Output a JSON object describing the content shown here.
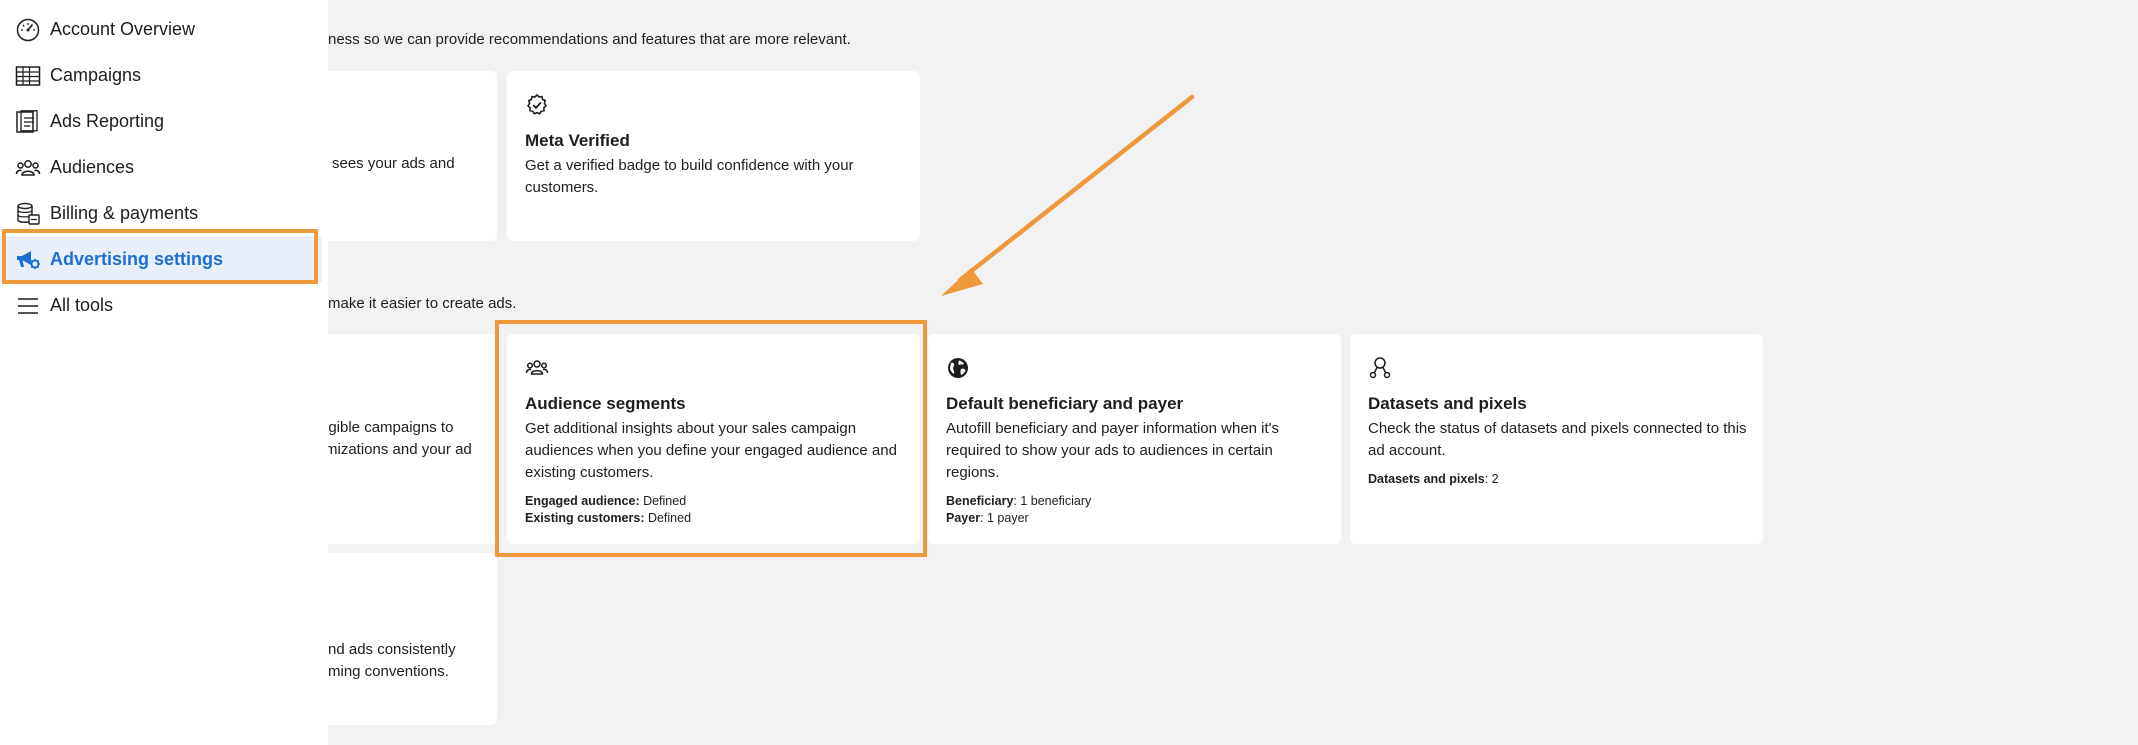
{
  "sidebar": {
    "items": [
      {
        "label": "Account Overview",
        "icon": "speedometer-icon"
      },
      {
        "label": "Campaigns",
        "icon": "table-icon"
      },
      {
        "label": "Ads Reporting",
        "icon": "report-icon"
      },
      {
        "label": "Audiences",
        "icon": "people-icon"
      },
      {
        "label": "Billing & payments",
        "icon": "coins-icon"
      },
      {
        "label": "Advertising settings",
        "icon": "megaphone-gear-icon",
        "active": true
      },
      {
        "label": "All tools",
        "icon": "menu-icon"
      }
    ]
  },
  "main": {
    "section1_desc": "ness so we can provide recommendations and features that are more relevant.",
    "section2_desc": "make it easier to create ads.",
    "partial_card_1": {
      "line1": "sees your ads and"
    },
    "partial_card_2": {
      "line1": "igible campaigns to",
      "line2": "mizations and your ad"
    },
    "partial_card_3": {
      "line1": "nd ads consistently",
      "line2": "ming conventions."
    },
    "meta_verified": {
      "title": "Meta Verified",
      "desc": "Get a verified badge to build confidence with your customers.",
      "icon": "verified-badge-icon"
    },
    "audience_segments": {
      "title": "Audience segments",
      "desc": "Get additional insights about your sales campaign audiences when you define your engaged audience and existing customers.",
      "icon": "people-icon",
      "meta1_label": "Engaged audience:",
      "meta1_value": " Defined",
      "meta2_label": "Existing customers:",
      "meta2_value": " Defined"
    },
    "beneficiary": {
      "title": "Default beneficiary and payer",
      "desc": "Autofill beneficiary and payer information when it's required to show your ads to audiences in certain regions.",
      "icon": "globe-icon",
      "meta1_label": "Beneficiary",
      "meta1_value": ": 1 beneficiary",
      "meta2_label": "Payer",
      "meta2_value": ": 1 payer"
    },
    "datasets": {
      "title": "Datasets and pixels",
      "desc": "Check the status of datasets and pixels connected to this ad account.",
      "icon": "dataset-nodes-icon",
      "meta1_label": "Datasets and pixels",
      "meta1_value": ": 2"
    }
  },
  "colors": {
    "accent": "#1d6fd6",
    "annotation": "#ee9a3c",
    "background": "#f2f2f2"
  }
}
